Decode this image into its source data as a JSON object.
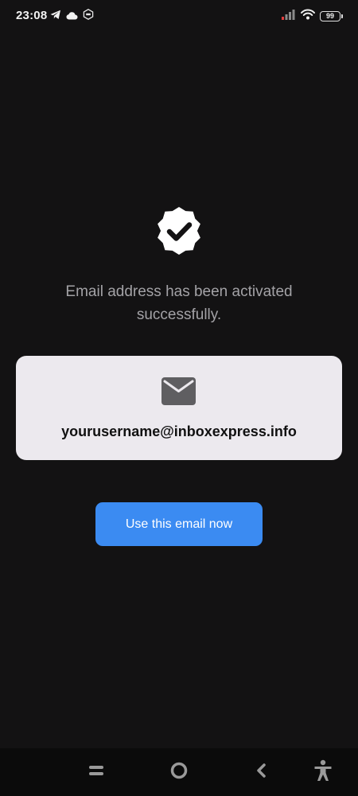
{
  "status_bar": {
    "time": "23:08",
    "battery_level": "99",
    "left_icons": [
      "telegram-icon",
      "cloud-icon",
      "vpn-badge-icon"
    ],
    "right_icons": [
      "signal-icon",
      "wifi-icon",
      "battery-icon"
    ]
  },
  "main": {
    "badge_icon": "verified-check-icon",
    "success_message": "Email address has been activated successfully.",
    "email_card": {
      "icon": "mail-icon",
      "email": "yourusername@inboxexpress.info"
    },
    "use_email_button_label": "Use this email now"
  },
  "nav_bar": {
    "items": [
      "recents-icon",
      "home-icon",
      "back-icon",
      "accessibility-icon"
    ]
  },
  "colors": {
    "background": "#131213",
    "card": "#ece9ee",
    "button": "#3b8bf2",
    "message_text": "#a3a2a6"
  }
}
